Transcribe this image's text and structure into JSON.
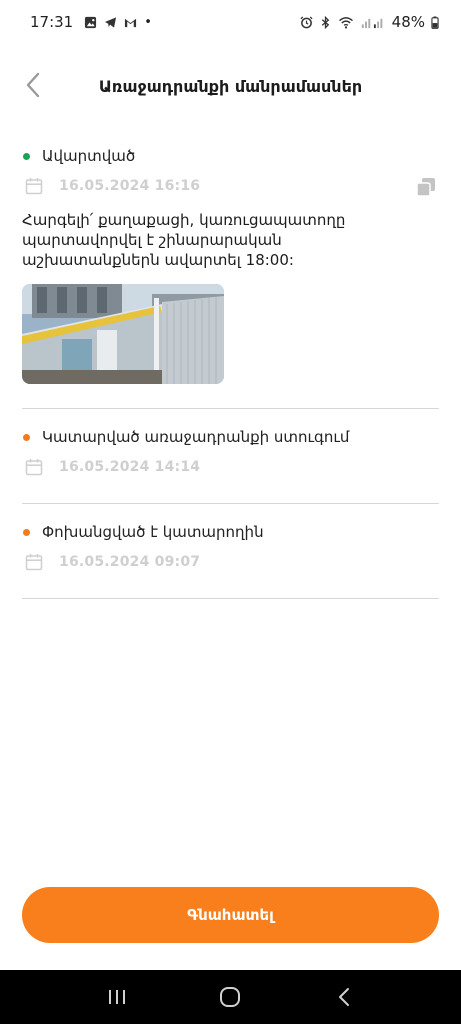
{
  "status_bar": {
    "time": "17:31",
    "battery": "48%",
    "dot": "•",
    "left_icons": [
      "gallery-icon",
      "telegram-icon",
      "gmail-icon"
    ],
    "right_icons": [
      "alarm-icon",
      "bluetooth-icon",
      "wifi-icon",
      "signal-icon",
      "battery-icon"
    ]
  },
  "header": {
    "title": "Առաջադրանքի մանրամասներ"
  },
  "timeline": [
    {
      "status": "Ավարտված",
      "status_color": "#1aa25a",
      "date": "16.05.2024 16:16",
      "message": "Հարգելի՛ քաղաքացի, կառուցապատողը պարտավորվել է շինարարական աշխատանքներն ավարտել 18:00:"
    },
    {
      "status": "Կատարված առաջադրանքի ստուգում",
      "status_color": "#f47a20",
      "date": "16.05.2024 14:14"
    },
    {
      "status": "Փոխանցված է կատարողին",
      "status_color": "#f47a20",
      "date": "16.05.2024 09:07"
    }
  ],
  "actions": {
    "submit_label": "Գնահատել"
  },
  "colors": {
    "accent": "#f97f1c",
    "completed": "#1aa25a",
    "pending": "#f47a20"
  }
}
